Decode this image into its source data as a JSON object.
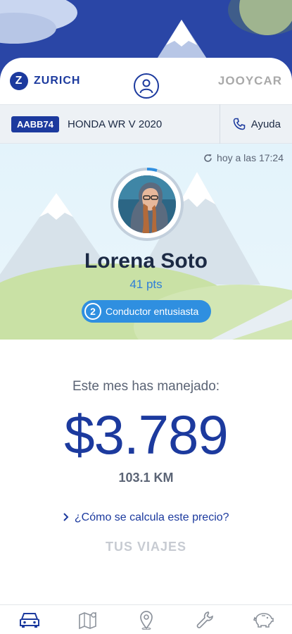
{
  "brand": {
    "zurich_logo_letter": "Z",
    "zurich_name": "ZURICH",
    "jooycar_name": "JOOYCAR"
  },
  "vehicle": {
    "plate": "AABB74",
    "model": "HONDA WR V 2020",
    "help_label": "Ayuda"
  },
  "profile": {
    "updated_text": "hoy a las 17:24",
    "name": "Lorena Soto",
    "points": "41 pts",
    "level_number": "2",
    "level_label": "Conductor entusiasta"
  },
  "summary": {
    "month_label": "Este mes has manejado:",
    "amount": "$3.789",
    "distance": "103.1 KM",
    "calc_link": "¿Cómo se calcula este precio?",
    "trips_label": "TUS VIAJES"
  },
  "tabs": [
    {
      "icon": "car-icon",
      "active": true
    },
    {
      "icon": "map-icon",
      "active": false
    },
    {
      "icon": "location-pin-icon",
      "active": false
    },
    {
      "icon": "wrench-icon",
      "active": false
    },
    {
      "icon": "piggy-bank-icon",
      "active": false
    }
  ],
  "colors": {
    "brand_blue": "#1c3a9e",
    "accent_blue": "#2f8fe0",
    "text_dark": "#1c2a44",
    "text_muted": "#5b6475"
  }
}
